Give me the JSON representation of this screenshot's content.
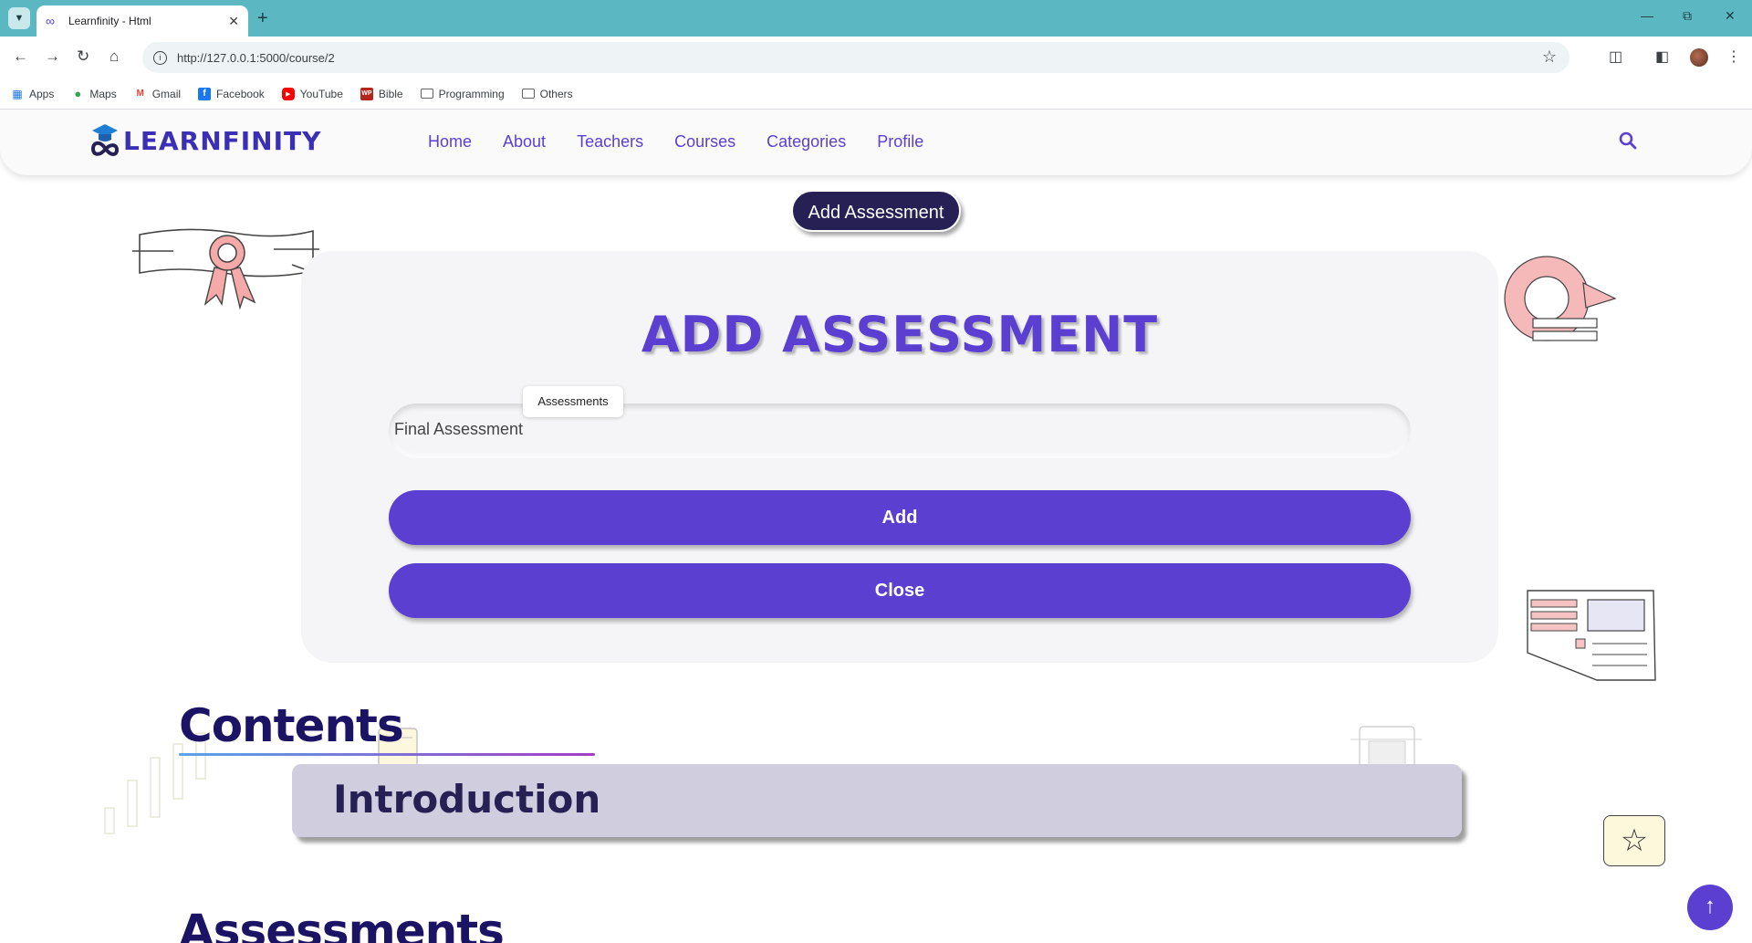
{
  "browser": {
    "tab_title": "Learnfinity - Html",
    "url": "http://127.0.0.1:5000/course/2",
    "bookmarks": [
      {
        "label": "Apps",
        "icon": "apps-grid-icon"
      },
      {
        "label": "Maps",
        "icon": "maps-pin-icon"
      },
      {
        "label": "Gmail",
        "icon": "gmail-icon"
      },
      {
        "label": "Facebook",
        "icon": "facebook-icon"
      },
      {
        "label": "YouTube",
        "icon": "youtube-icon"
      },
      {
        "label": "Bible",
        "icon": "bible-icon"
      },
      {
        "label": "Programming",
        "icon": "folder-icon"
      },
      {
        "label": "Others",
        "icon": "folder-icon"
      }
    ]
  },
  "site": {
    "logo_text": "LEARNFINITY",
    "nav": [
      "Home",
      "About",
      "Teachers",
      "Courses",
      "Categories",
      "Profile"
    ]
  },
  "main": {
    "add_assessment_button": "Add Assessment",
    "modal": {
      "title": "ADD ASSESSMENT",
      "field_tag": "Assessments",
      "field_value": "Final Assessment",
      "add_label": "Add",
      "close_label": "Close"
    },
    "contents_heading": "Contents",
    "contents_items": [
      "Introduction"
    ],
    "assessments_heading": "Assessments"
  },
  "colors": {
    "accent": "#5b3fd1",
    "dark": "#262055",
    "chrome": "#5bb8c3"
  }
}
